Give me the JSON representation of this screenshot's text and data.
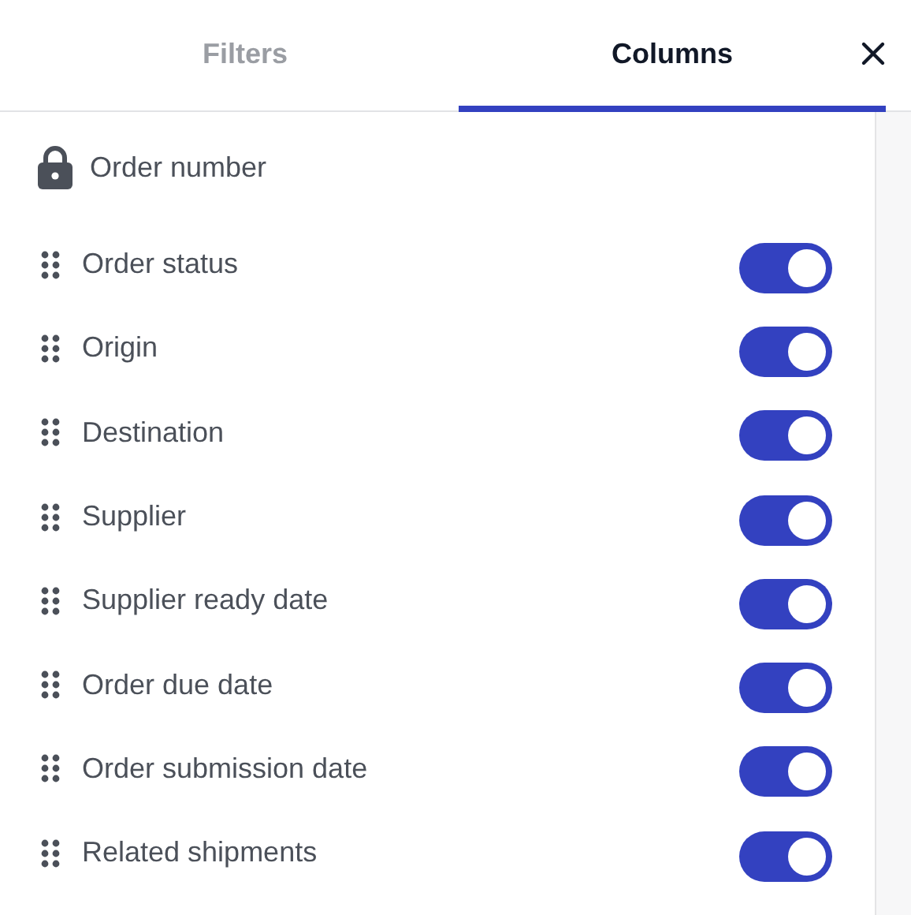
{
  "tabs": [
    {
      "label": "Filters",
      "selected": false
    },
    {
      "label": "Columns",
      "selected": true
    }
  ],
  "columns": [
    {
      "label": "Order number",
      "kind": "locked"
    },
    {
      "label": "Order status",
      "kind": "toggle",
      "on": true
    },
    {
      "label": "Origin",
      "kind": "toggle",
      "on": true
    },
    {
      "label": "Destination",
      "kind": "toggle",
      "on": true
    },
    {
      "label": "Supplier",
      "kind": "toggle",
      "on": true
    },
    {
      "label": "Supplier ready date",
      "kind": "toggle",
      "on": true
    },
    {
      "label": "Order due date",
      "kind": "toggle",
      "on": true
    },
    {
      "label": "Order submission date",
      "kind": "toggle",
      "on": true
    },
    {
      "label": "Related shipments",
      "kind": "toggle",
      "on": true
    }
  ]
}
